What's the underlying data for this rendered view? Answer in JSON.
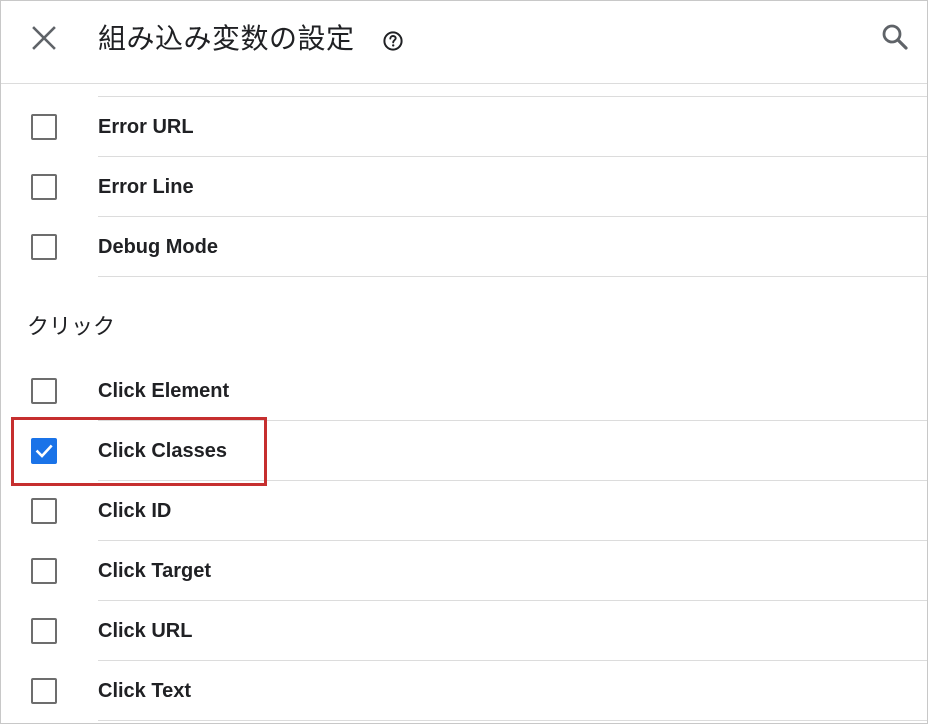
{
  "header": {
    "title": "組み込み変数の設定",
    "close_icon": "close-icon",
    "help_icon": "help-circle-icon",
    "search_icon": "search-icon"
  },
  "errors_group": {
    "items": [
      {
        "label": "Error URL",
        "checked": false
      },
      {
        "label": "Error Line",
        "checked": false
      },
      {
        "label": "Debug Mode",
        "checked": false
      }
    ]
  },
  "click_group": {
    "title": "クリック",
    "items": [
      {
        "label": "Click Element",
        "checked": false
      },
      {
        "label": "Click Classes",
        "checked": true
      },
      {
        "label": "Click ID",
        "checked": false
      },
      {
        "label": "Click Target",
        "checked": false
      },
      {
        "label": "Click URL",
        "checked": false
      },
      {
        "label": "Click Text",
        "checked": false
      }
    ]
  },
  "colors": {
    "checkbox_checked": "#1a73e8",
    "highlight_border": "#c62f2f"
  }
}
